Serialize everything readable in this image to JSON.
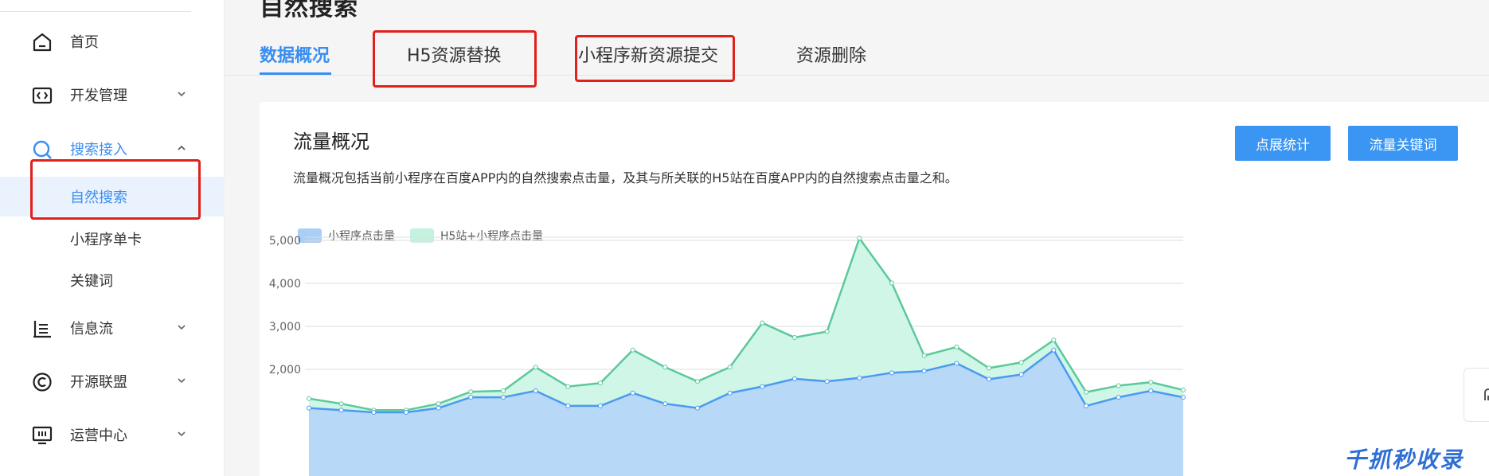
{
  "page": {
    "title": "自然搜索"
  },
  "sidebar": {
    "items": [
      {
        "label": "首页",
        "icon": "home-icon"
      },
      {
        "label": "开发管理",
        "icon": "code-icon"
      },
      {
        "label": "搜索接入",
        "icon": "search-icon",
        "active": true,
        "expanded": true
      },
      {
        "label": "信息流",
        "icon": "feed-icon"
      },
      {
        "label": "开源联盟",
        "icon": "copyright-icon"
      },
      {
        "label": "运营中心",
        "icon": "monitor-icon"
      }
    ],
    "subitems": [
      {
        "label": "自然搜索",
        "selected": true
      },
      {
        "label": "小程序单卡"
      },
      {
        "label": "关键词"
      }
    ]
  },
  "tabs": [
    {
      "label": "数据概况",
      "active": true
    },
    {
      "label": "H5资源替换"
    },
    {
      "label": "小程序新资源提交"
    },
    {
      "label": "资源删除"
    }
  ],
  "card": {
    "title": "流量概况",
    "description": "流量概况包括当前小程序在百度APP内的自然搜索点击量，及其与所关联的H5站在百度APP内的自然搜索点击量之和。",
    "buttons": {
      "impression": "点展统计",
      "keywords": "流量关键词"
    }
  },
  "watermark": "千抓秒收录",
  "colors": {
    "accent": "#3a8ef0",
    "series1_fill": "#b5d6f8",
    "series1_line": "#4a9af0",
    "series2_fill": "#cdf5e6",
    "series2_line": "#5cc99a",
    "highlight_box": "#e0201a"
  },
  "chart_data": {
    "type": "area",
    "legend": [
      "小程序点击量",
      "H5站+小程序点击量"
    ],
    "yticks": [
      "5,000",
      "4,000",
      "3,000",
      "2,000"
    ],
    "ylim": [
      0,
      5200
    ],
    "series": [
      {
        "name": "小程序点击量",
        "values": [
          1100,
          1050,
          1000,
          1000,
          1100,
          1350,
          1350,
          1500,
          1150,
          1150,
          1450,
          1200,
          1100,
          1450,
          1600,
          1780,
          1720,
          1800,
          1920,
          1960,
          2140,
          1770,
          1880,
          2450,
          1150,
          1350,
          1500,
          1350
        ]
      },
      {
        "name": "H5站+小程序点击量",
        "values": [
          1320,
          1200,
          1050,
          1050,
          1200,
          1480,
          1500,
          2050,
          1600,
          1680,
          2450,
          2050,
          1720,
          2050,
          3080,
          2740,
          2880,
          5050,
          4010,
          2320,
          2520,
          2030,
          2160,
          2680,
          1470,
          1620,
          1700,
          1520
        ]
      }
    ]
  }
}
